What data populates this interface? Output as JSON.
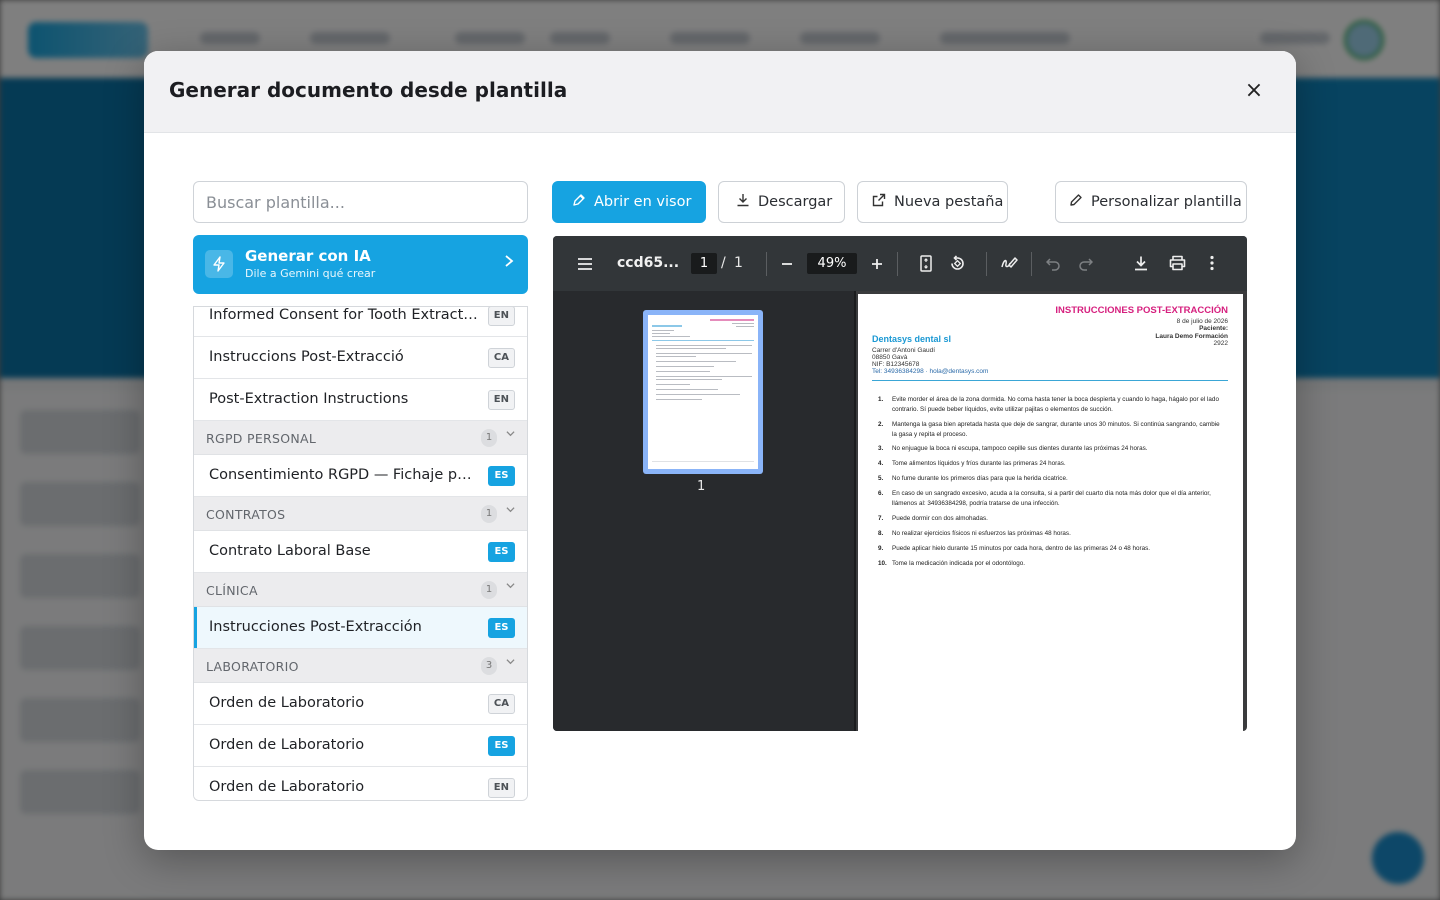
{
  "modal": {
    "title": "Generar documento desde plantilla",
    "close_glyph": "×"
  },
  "search": {
    "placeholder": "Buscar plantilla..."
  },
  "ai": {
    "title": "Generar con IA",
    "subtitle": "Dile a Gemini qué crear"
  },
  "templates": {
    "partial_item": {
      "label": "Informed Consent for Tooth Extracti...",
      "lang": "EN"
    },
    "items_top": [
      {
        "label": "Instruccions Post-Extracció",
        "lang": "CA"
      },
      {
        "label": "Post-Extraction Instructions",
        "lang": "EN"
      }
    ],
    "groups": [
      {
        "name": "RGPD PERSONAL",
        "count": "1",
        "items": [
          {
            "label": "Consentimiento RGPD — Fichaje por...",
            "lang": "ES"
          }
        ]
      },
      {
        "name": "CONTRATOS",
        "count": "1",
        "items": [
          {
            "label": "Contrato Laboral Base",
            "lang": "ES"
          }
        ]
      },
      {
        "name": "CLÍNICA",
        "count": "1",
        "items": [
          {
            "label": "Instrucciones Post-Extracción",
            "lang": "ES",
            "selected": true
          }
        ]
      },
      {
        "name": "LABORATORIO",
        "count": "3",
        "items": [
          {
            "label": "Orden de Laboratorio",
            "lang": "CA"
          },
          {
            "label": "Orden de Laboratorio",
            "lang": "ES"
          },
          {
            "label": "Orden de Laboratorio",
            "lang": "EN"
          }
        ]
      }
    ]
  },
  "actions": {
    "open_viewer": "Abrir en visor",
    "download": "Descargar",
    "new_tab": "Nueva pestaña",
    "customize": "Personalizar plantilla"
  },
  "viewer": {
    "filename": "ccd65...",
    "current_page": "1",
    "separator": "/",
    "total_pages": "1",
    "zoom": "49%",
    "thumb_label": "1"
  },
  "document": {
    "title": "INSTRUCCIONES POST-EXTRACCIÓN",
    "date": "8 de julio de 2026",
    "patient_label": "Paciente:",
    "patient_name": "Laura Demo Formación",
    "patient_id": "2922",
    "company": "Dentasys dental sl",
    "address": "Carrer d'Antoni Gaudí",
    "city": "08850 Gavà",
    "nif": "NIF: B12345678",
    "contact": "Tel: 34936384298 · hola@dentasys.com",
    "instructions": [
      "Evite morder el área de la zona dormida. No coma hasta tener la boca despierta y cuando lo haga, hágalo por el lado contrario. Sí puede beber líquidos, evite utilizar pajitas o elementos de succión.",
      "Mantenga la gasa bien apretada hasta que deje de sangrar, durante unos 30 minutos. Si continúa sangrando, cambie la gasa y repita el proceso.",
      "No enjuague la boca ni escupa, tampoco cepille sus dientes durante las próximas 24 horas.",
      "Tome alimentos líquidos y fríos durante las primeras 24 horas.",
      "No fume durante los primeros días para que la herida cicatrice.",
      "En caso de un sangrado excesivo, acuda a la consulta, si a partir del cuarto día nota más dolor que el día anterior, llámenos al: 34936384298, podría tratarse de una infección.",
      "Puede dormir con dos almohadas.",
      "No realizar ejercicios físicos ni esfuerzos las próximas 48 horas.",
      "Puede aplicar hielo durante 15 minutos por cada hora, dentro de las primeras 24 o 48 horas.",
      "Tome la medicación indicada por el odontólogo."
    ]
  },
  "colors": {
    "accent": "#16a3e1",
    "doc_title": "#d61f7e",
    "doc_company": "#1a98d3",
    "viewer_toolbar": "#323639"
  }
}
